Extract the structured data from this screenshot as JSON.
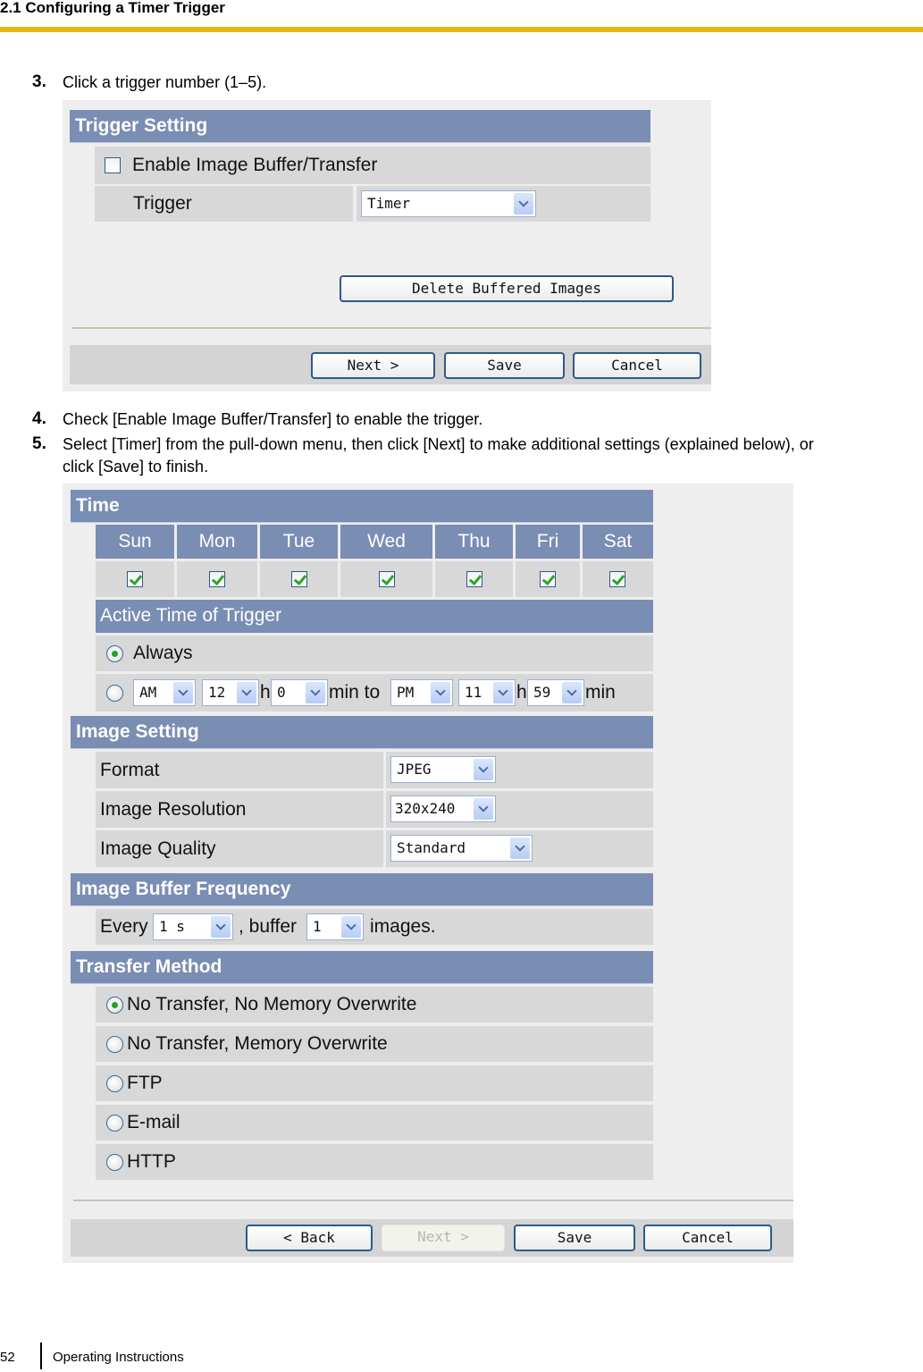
{
  "header": {
    "title": "2.1 Configuring a Timer Trigger",
    "accent_color": "#e2b910"
  },
  "steps": [
    {
      "num": "3.",
      "text": "Click a trigger number (1–5)."
    },
    {
      "num": "4.",
      "text": "Check [Enable Image Buffer/Transfer] to enable the trigger."
    },
    {
      "num": "5.",
      "text": "Select [Timer] from the pull-down menu, then click [Next] to make additional settings (explained below), or",
      "text2": "click [Save] to finish."
    }
  ],
  "trigger_setting": {
    "title": "Trigger Setting",
    "enable_label": "Enable Image Buffer/Transfer",
    "enable_checked": false,
    "trigger_label": "Trigger",
    "trigger_value": "Timer",
    "delete_button": "Delete Buffered Images",
    "buttons": {
      "next": "Next >",
      "save": "Save",
      "cancel": "Cancel"
    }
  },
  "timer": {
    "time_title": "Time",
    "days": [
      {
        "label": "Sun",
        "checked": true
      },
      {
        "label": "Mon",
        "checked": true
      },
      {
        "label": "Tue",
        "checked": true
      },
      {
        "label": "Wed",
        "checked": true
      },
      {
        "label": "Thu",
        "checked": true
      },
      {
        "label": "Fri",
        "checked": true
      },
      {
        "label": "Sat",
        "checked": true
      }
    ],
    "active_title": "Active Time of Trigger",
    "always_label": "Always",
    "always_selected": true,
    "range": {
      "start_ampm": "AM",
      "start_hour": "12",
      "h_label": "h",
      "start_min": "0",
      "min_to_label": "min to",
      "end_ampm": "PM",
      "end_hour": "11",
      "end_min": "59",
      "min_label": "min"
    },
    "image_setting_title": "Image Setting",
    "format_label": "Format",
    "format_value": "JPEG",
    "resolution_label": "Image Resolution",
    "resolution_value": "320x240",
    "quality_label": "Image Quality",
    "quality_value": "Standard",
    "frequency_title": "Image Buffer Frequency",
    "every_label": "Every",
    "every_value": "1 s",
    "buffer_label": ", buffer",
    "buffer_value": "1",
    "images_label": "images.",
    "transfer_title": "Transfer Method",
    "transfer_options": [
      {
        "label": "No Transfer, No Memory Overwrite",
        "selected": true
      },
      {
        "label": "No Transfer, Memory Overwrite",
        "selected": false
      },
      {
        "label": "FTP",
        "selected": false
      },
      {
        "label": "E-mail",
        "selected": false
      },
      {
        "label": "HTTP",
        "selected": false
      }
    ],
    "buttons": {
      "back": "< Back",
      "next": "Next >",
      "save": "Save",
      "cancel": "Cancel"
    }
  },
  "footer": {
    "page": "52",
    "doc_name": "Operating Instructions"
  }
}
